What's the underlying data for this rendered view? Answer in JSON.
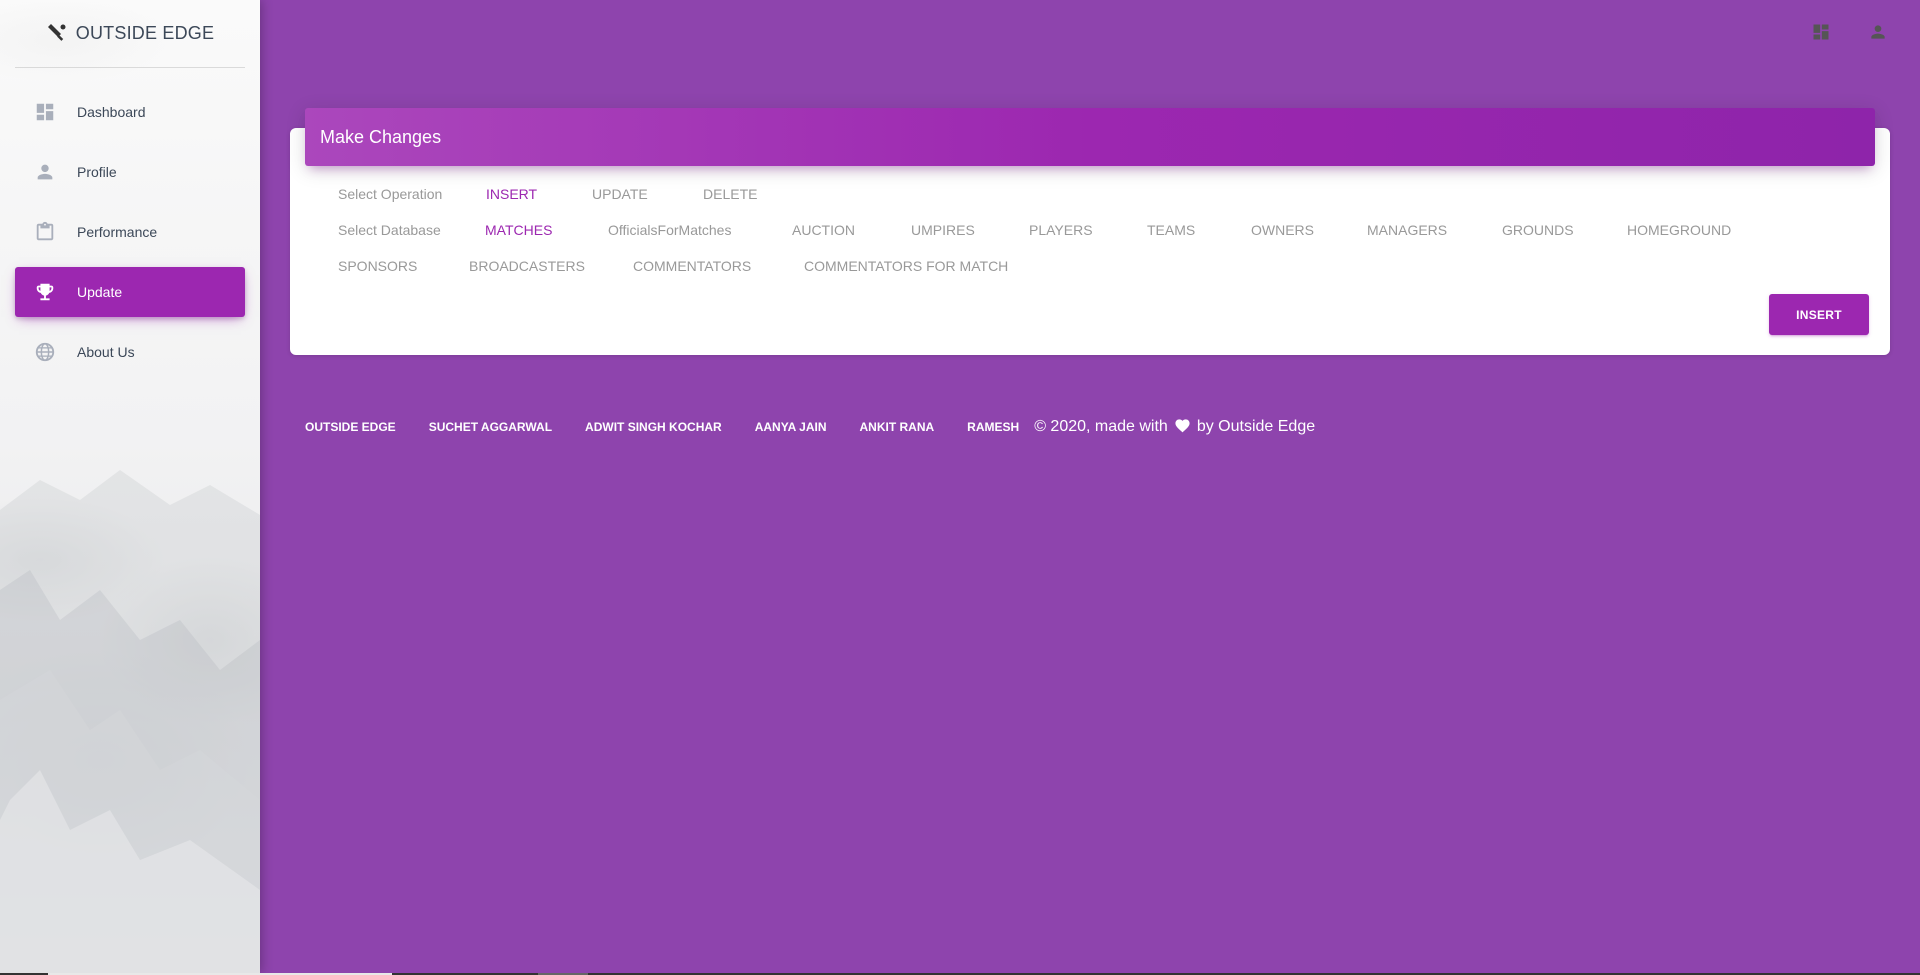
{
  "brand": {
    "title": "OUTSIDE EDGE",
    "logo_icon": "cricket-bat-icon"
  },
  "sidebar": {
    "items": [
      {
        "label": "Dashboard",
        "icon": "dashboard-icon",
        "active": false
      },
      {
        "label": "Profile",
        "icon": "person-icon",
        "active": false
      },
      {
        "label": "Performance",
        "icon": "clipboard-icon",
        "active": false
      },
      {
        "label": "Update",
        "icon": "trophy-icon",
        "active": true
      },
      {
        "label": "About Us",
        "icon": "globe-icon",
        "active": false
      }
    ]
  },
  "topbar": {
    "icons": [
      "dashboard-icon",
      "person-icon"
    ]
  },
  "card": {
    "title": "Make Changes",
    "operation_label": "Select Operation",
    "operations": [
      "INSERT",
      "UPDATE",
      "DELETE"
    ],
    "selected_operation": "INSERT",
    "database_label": "Select Database",
    "databases_row1": [
      "MATCHES",
      "OfficialsForMatches",
      "AUCTION",
      "UMPIRES",
      "PLAYERS",
      "TEAMS",
      "OWNERS",
      "MANAGERS",
      "GROUNDS",
      "HOMEGROUND"
    ],
    "databases_row2": [
      "SPONSORS",
      "BROADCASTERS",
      "COMMENTATORS",
      "COMMENTATORS FOR MATCH"
    ],
    "selected_database": "MATCHES",
    "submit_label": "INSERT"
  },
  "footer": {
    "links": [
      "OUTSIDE EDGE",
      "SUCHET AGGARWAL",
      "ADWIT SINGH KOCHAR",
      "AANYA JAIN",
      "ANKIT RANA",
      "RAMESH"
    ],
    "copyright_prefix": "© 2020, made with",
    "copyright_suffix": "by Outside Edge",
    "heart_icon": "heart-icon"
  },
  "colors": {
    "background": "#8e44ad",
    "accent": "#9c27b0",
    "sidebar_text": "#3c4858",
    "muted_text": "#999999"
  }
}
